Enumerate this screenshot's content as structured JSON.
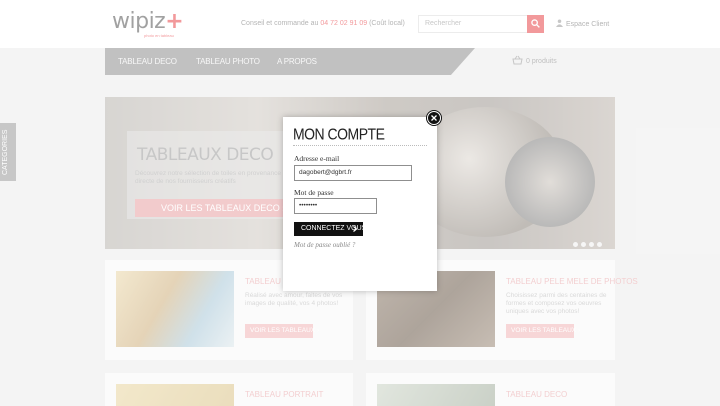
{
  "header": {
    "logo": "wipiz",
    "logo_plus": "+",
    "logo_sub": "photo en tableau",
    "contact_prefix": "Conseil et commande au",
    "phone": "04 72 02 91 09",
    "contact_suffix": "(Coût local)",
    "search_placeholder": "Rechercher",
    "account_label": "Espace Client"
  },
  "nav": {
    "items": [
      "TABLEAU DECO",
      "TABLEAU PHOTO",
      "A PROPOS"
    ],
    "cart_label": "0 produits"
  },
  "side_tab": {
    "label": "CATEGORIES"
  },
  "hero": {
    "title": "TABLEAUX DECO",
    "text": "Découvrez notre sélection de toiles en provenance directe de nos fournisseurs créatifs",
    "button": "VOIR LES TABLEAUX DECO"
  },
  "cards": [
    {
      "title": "TABLEAU PH...",
      "text": "Réalisé avec amour, faites de vos images de qualité, vos 4 photos!",
      "button": "VOIR LES TABLEAUX"
    },
    {
      "title": "TABLEAU PELE MELE DE PHOTOS",
      "text": "Choisissez parmi des centaines de formes et composez vos oeuvres uniques avec vos photos!",
      "button": "VOIR LES TABLEAUX"
    },
    {
      "title": "TABLEAU PORTRAIT",
      "text": "",
      "button": ""
    },
    {
      "title": "TABLEAU DECO",
      "text": "",
      "button": ""
    }
  ],
  "modal": {
    "title": "MON COMPTE",
    "email_label": "Adresse e-mail",
    "email_value": "dagobert@dgbrt.fr",
    "password_label": "Mot de passe",
    "password_value": "••••••••",
    "connect_button": "CONNECTEZ VOUS",
    "forgot_link": "Mot de passe oublié ?"
  },
  "colors": {
    "accent": "#e8454a",
    "nav": "#8f8f8f",
    "button_dark": "#111111"
  }
}
